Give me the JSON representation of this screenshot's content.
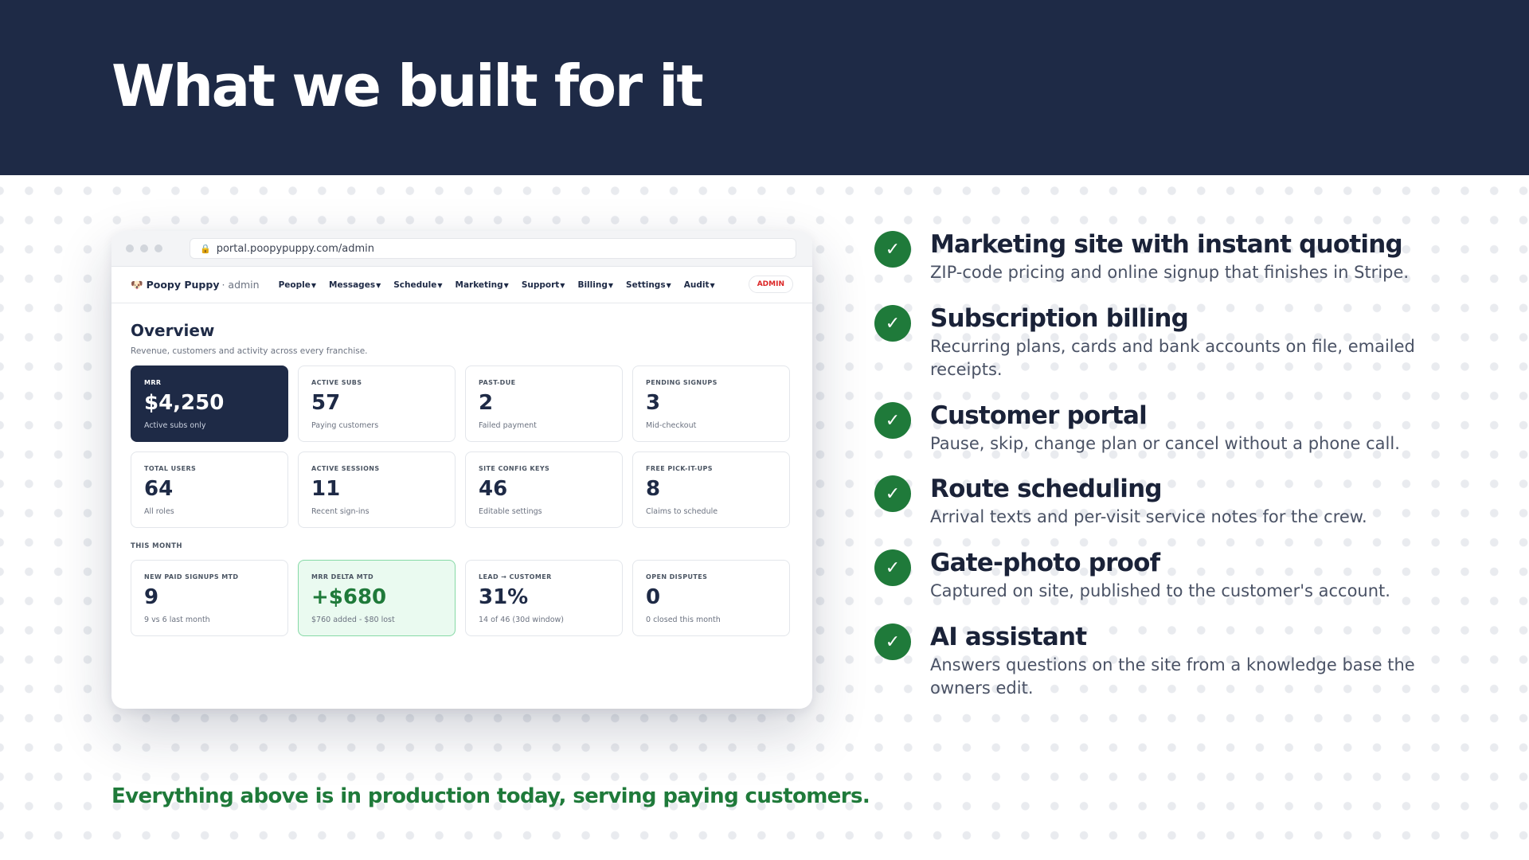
{
  "slide": {
    "title": "What we built for it",
    "footer": "Everything above is in production today, serving paying customers."
  },
  "browser": {
    "url": "portal.poopypuppy.com/admin"
  },
  "app": {
    "brand": "Poopy Puppy",
    "brand_sub": "· admin",
    "nav": [
      {
        "label": "People"
      },
      {
        "label": "Messages"
      },
      {
        "label": "Schedule"
      },
      {
        "label": "Marketing"
      },
      {
        "label": "Support"
      },
      {
        "label": "Billing"
      },
      {
        "label": "Settings"
      },
      {
        "label": "Audit"
      }
    ],
    "badge": "ADMIN",
    "overview": {
      "title": "Overview",
      "subtitle": "Revenue, customers and activity across every franchise."
    },
    "cards_row1": [
      {
        "label": "MRR",
        "value": "$4,250",
        "note": "Active subs only"
      },
      {
        "label": "ACTIVE SUBS",
        "value": "57",
        "note": "Paying customers"
      },
      {
        "label": "PAST-DUE",
        "value": "2",
        "note": "Failed payment"
      },
      {
        "label": "PENDING SIGNUPS",
        "value": "3",
        "note": "Mid-checkout"
      }
    ],
    "cards_row2": [
      {
        "label": "TOTAL USERS",
        "value": "64",
        "note": "All roles"
      },
      {
        "label": "ACTIVE SESSIONS",
        "value": "11",
        "note": "Recent sign-ins"
      },
      {
        "label": "SITE CONFIG KEYS",
        "value": "46",
        "note": "Editable settings"
      },
      {
        "label": "FREE PICK-IT-UPS",
        "value": "8",
        "note": "Claims to schedule"
      }
    ],
    "section_label": "THIS MONTH",
    "cards_row3": [
      {
        "label": "NEW PAID SIGNUPS MTD",
        "value": "9",
        "note": "9 vs 6 last month"
      },
      {
        "label": "MRR DELTA MTD",
        "value": "+$680",
        "note": "$760 added - $80 lost"
      },
      {
        "label": "LEAD → CUSTOMER",
        "value": "31%",
        "note": "14 of 46 (30d window)"
      },
      {
        "label": "OPEN DISPUTES",
        "value": "0",
        "note": "0 closed this month"
      }
    ]
  },
  "features": [
    {
      "title": "Marketing site with instant quoting",
      "desc": "ZIP-code pricing and online signup that finishes in Stripe."
    },
    {
      "title": "Subscription billing",
      "desc": "Recurring plans, cards and bank accounts on file, emailed receipts."
    },
    {
      "title": "Customer portal",
      "desc": "Pause, skip, change plan or cancel without a phone call."
    },
    {
      "title": "Route scheduling",
      "desc": "Arrival texts and per-visit service notes for the crew."
    },
    {
      "title": "Gate-photo proof",
      "desc": "Captured on site, published to the customer's account."
    },
    {
      "title": "AI assistant",
      "desc": "Answers questions on the site from a knowledge base the owners edit."
    }
  ],
  "colors": {
    "navy": "#1e2a46",
    "brand_green": "#1f7a3a",
    "alert_red": "#dc2626"
  },
  "icons": {
    "feature_check": "check-icon",
    "url_lock": "lock-icon",
    "nav_caret": "caret-down-icon"
  }
}
